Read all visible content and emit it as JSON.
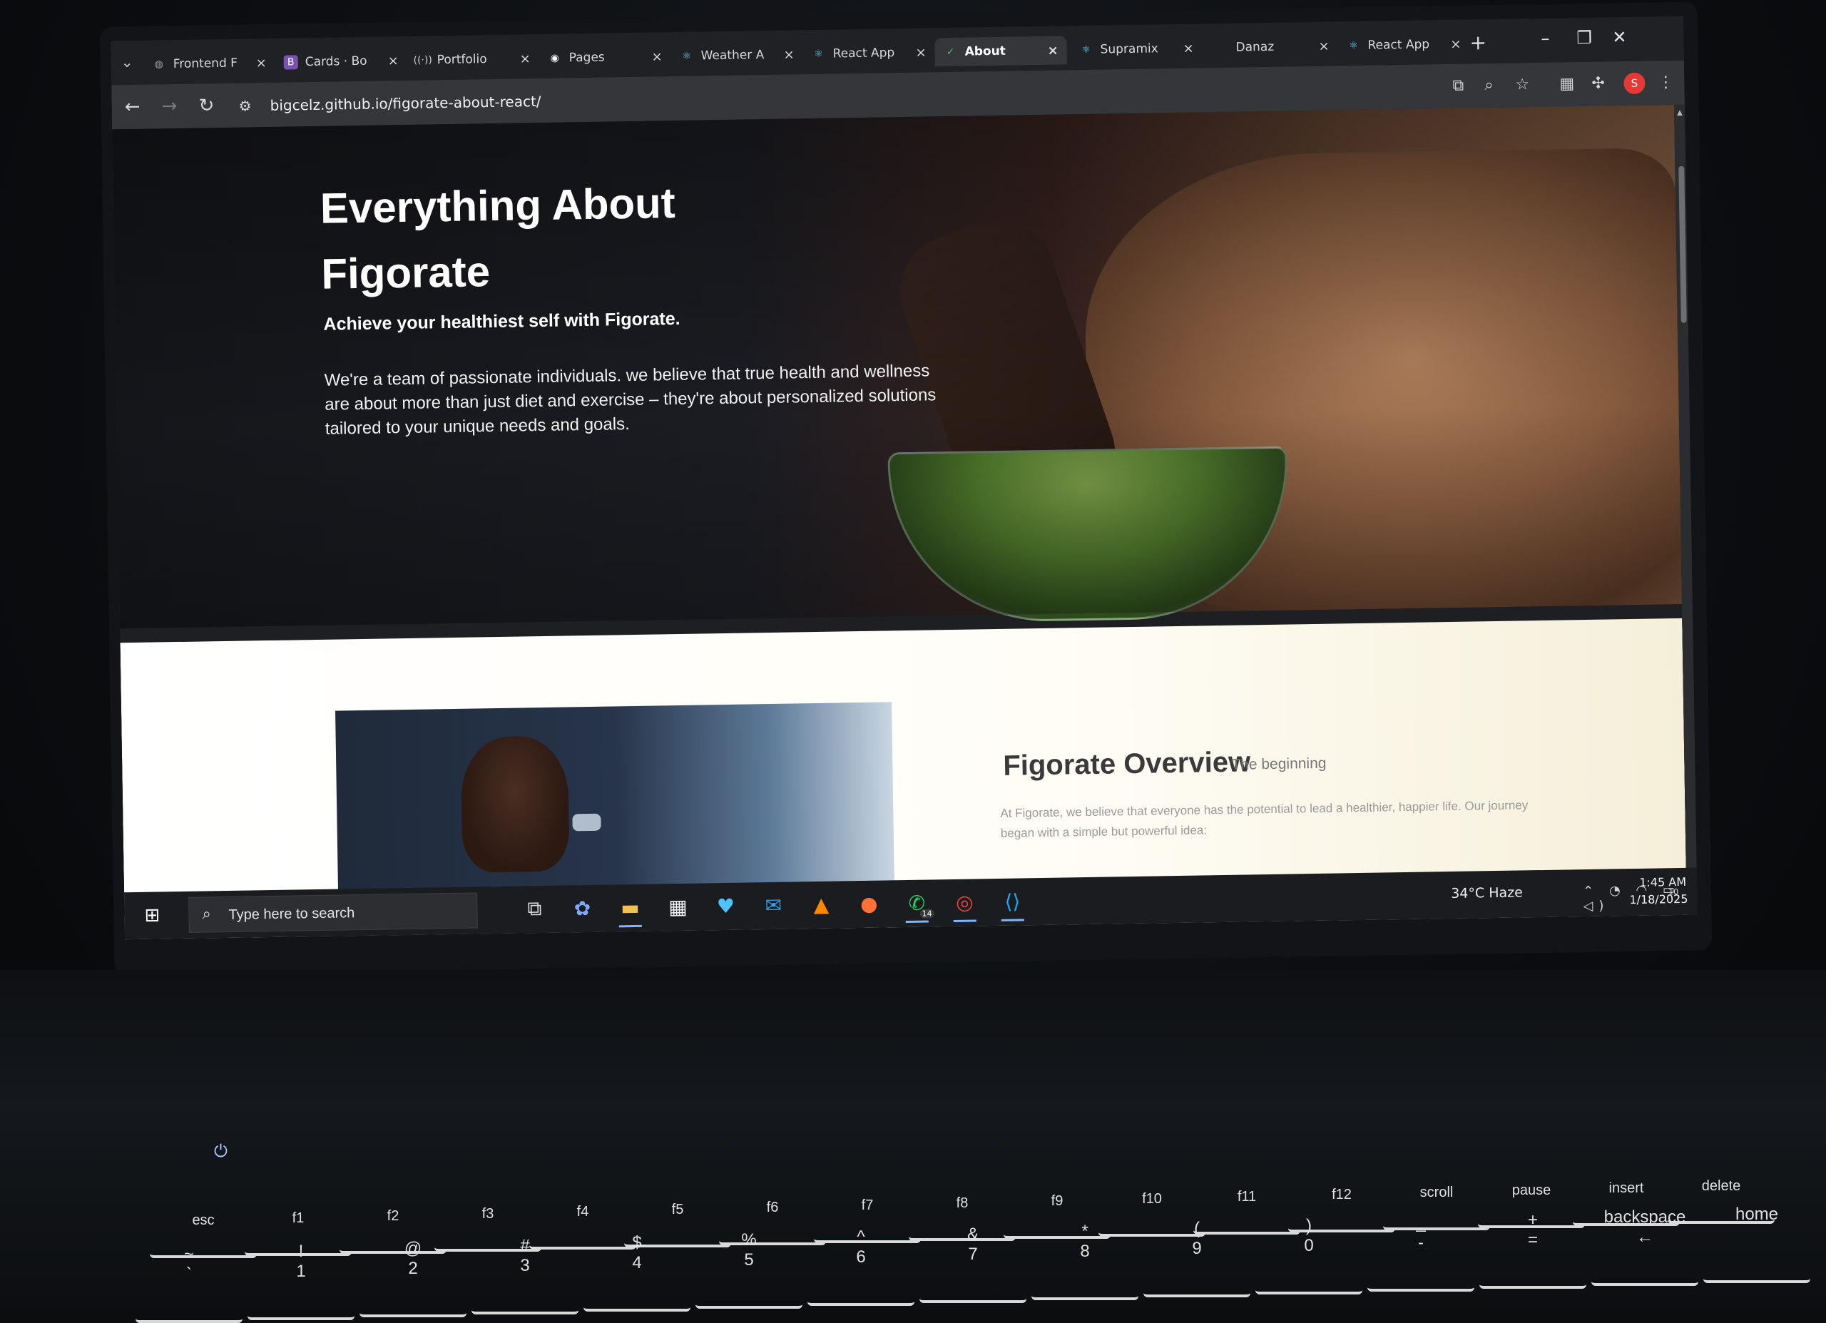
{
  "browser": {
    "tabs": [
      {
        "title": "Frontend F",
        "icon": "globe-icon",
        "icon_color": "#9aa0a6",
        "active": false
      },
      {
        "title": "Cards · Bo",
        "icon": "bootstrap-icon",
        "icon_color": "#7952b3",
        "active": false
      },
      {
        "title": "Portfolio",
        "icon": "broadcast-icon",
        "icon_color": "#cfcfcf",
        "active": false
      },
      {
        "title": "Pages",
        "icon": "github-icon",
        "icon_color": "#ffffff",
        "active": false
      },
      {
        "title": "Weather A",
        "icon": "react-icon",
        "icon_color": "#61dafb",
        "active": false
      },
      {
        "title": "React App",
        "icon": "react-icon",
        "icon_color": "#61dafb",
        "active": false
      },
      {
        "title": "About",
        "icon": "figorate-icon",
        "icon_color": "#3fbf6f",
        "active": true
      },
      {
        "title": "Supramix",
        "icon": "react-icon",
        "icon_color": "#61dafb",
        "active": false
      },
      {
        "title": "Danaz",
        "icon": "blank-icon",
        "icon_color": "#9aa0a6",
        "active": false
      },
      {
        "title": "React App",
        "icon": "react-icon",
        "icon_color": "#61dafb",
        "active": false
      }
    ],
    "close_glyph": "×",
    "new_tab_glyph": "+",
    "url": "bigcelz.github.io/figorate-about-react/",
    "profile_initial": "S",
    "profile_color": "#e53935"
  },
  "page": {
    "hero": {
      "title": "Everything About Figorate",
      "subtitle": "Achieve your healthiest self with Figorate.",
      "body": "We're a team of passionate individuals. we believe that true health and wellness are about more than just diet and exercise – they're about personalized solutions tailored to your unique needs and goals."
    },
    "overview": {
      "title": "Figorate Overview",
      "tagline": "The beginning",
      "body": "At Figorate, we believe that everyone has the potential to lead a healthier, happier life. Our journey began with a simple but powerful idea:"
    }
  },
  "taskbar": {
    "search_placeholder": "Type here to search",
    "weather": "34°C  Haze",
    "time": "1:45 AM",
    "date": "1/18/2025",
    "whatsapp_badge": "14",
    "notification_count": "10",
    "apps": [
      "task-view-icon",
      "copilot-icon",
      "file-explorer-icon",
      "microsoft-store-icon",
      "health-icon",
      "mail-icon",
      "vlc-icon",
      "firefox-icon",
      "whatsapp-icon",
      "chrome-icon",
      "vscode-icon"
    ]
  },
  "keyboard": {
    "fn_row": [
      "esc",
      "f1",
      "f2",
      "f3",
      "f4",
      "f5",
      "f6",
      "f7",
      "f8",
      "f9",
      "f10",
      "f11",
      "f12",
      "scroll",
      "pause",
      "insert",
      "delete"
    ],
    "number_row": [
      {
        "top": "~",
        "bottom": "`"
      },
      {
        "top": "!",
        "bottom": "1"
      },
      {
        "top": "@",
        "bottom": "2"
      },
      {
        "top": "#",
        "bottom": "3"
      },
      {
        "top": "$",
        "bottom": "4"
      },
      {
        "top": "%",
        "bottom": "5"
      },
      {
        "top": "^",
        "bottom": "6"
      },
      {
        "top": "&",
        "bottom": "7"
      },
      {
        "top": "*",
        "bottom": "8"
      },
      {
        "top": "(",
        "bottom": "9"
      },
      {
        "top": ")",
        "bottom": "0"
      },
      {
        "top": "_",
        "bottom": "-"
      },
      {
        "top": "+",
        "bottom": "="
      },
      {
        "top": "backspace",
        "bottom": "←"
      },
      {
        "top": "home",
        "bottom": ""
      }
    ]
  }
}
